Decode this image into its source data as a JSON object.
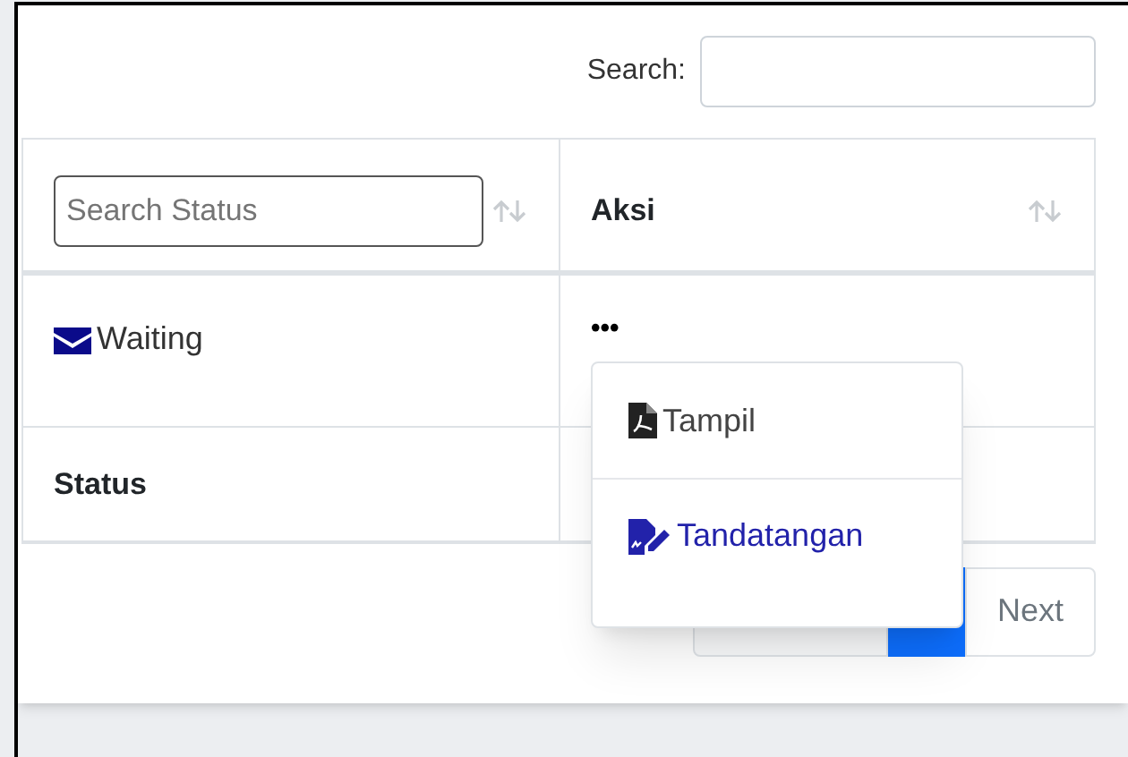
{
  "search": {
    "label": "Search:"
  },
  "table": {
    "header": [
      {
        "kind": "filter",
        "placeholder": "Search Status"
      },
      {
        "kind": "title",
        "label": "Aksi"
      }
    ],
    "rows": [
      {
        "status": "Waiting",
        "action": "•••"
      }
    ],
    "footer": [
      "Status"
    ]
  },
  "dropdown": {
    "items": [
      {
        "label": "Tampil",
        "kind": "pdf",
        "selected": false
      },
      {
        "label": "Tandatangan",
        "kind": "sign",
        "selected": true
      }
    ]
  },
  "pagination": {
    "next": "Next"
  }
}
